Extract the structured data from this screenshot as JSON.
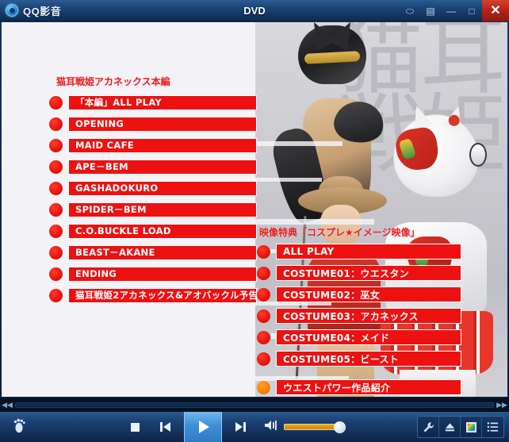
{
  "titlebar": {
    "app_name": "QQ影音",
    "title": "DVD",
    "buttons": [
      {
        "name": "feedback-button",
        "icon": "speech-bubble-icon",
        "glyph": "⬭"
      },
      {
        "name": "skin-button",
        "icon": "form-list-icon",
        "glyph": "▤"
      },
      {
        "name": "minimize-button",
        "icon": "minimize-icon",
        "glyph": "—"
      },
      {
        "name": "maximize-button",
        "icon": "maximize-icon",
        "glyph": "□"
      },
      {
        "name": "close-button",
        "icon": "close-icon",
        "glyph": "✕"
      }
    ]
  },
  "dvd_menu": {
    "left": {
      "title": "猫耳戦姫アカネックス本編",
      "items": [
        {
          "label": "「本編」ALL PLAY",
          "bullet": "red"
        },
        {
          "label": "OPENING",
          "bullet": "red"
        },
        {
          "label": "MAID CAFE",
          "bullet": "red"
        },
        {
          "label": "APE－BEM",
          "bullet": "red"
        },
        {
          "label": "GASHADOKURO",
          "bullet": "red"
        },
        {
          "label": "SPIDER－BEM",
          "bullet": "red"
        },
        {
          "label": "C.O.BUCKLE LOAD",
          "bullet": "red"
        },
        {
          "label": "BEAST－AKANE",
          "bullet": "red"
        },
        {
          "label": "ENDING",
          "bullet": "red"
        },
        {
          "label": "猫耳戦姫2アカネックス&アオバックル予告",
          "bullet": "red"
        }
      ]
    },
    "right": {
      "title": "映像特典「コスプレ★イメージ映像」",
      "items": [
        {
          "label": "ALL  PLAY",
          "bullet": "red"
        },
        {
          "label": "COSTUME01：ウエスタン",
          "bullet": "red"
        },
        {
          "label": "COSTUME02：巫女",
          "bullet": "red"
        },
        {
          "label": "COSTUME03：アカネックス",
          "bullet": "red"
        },
        {
          "label": "COSTUME04：メイド",
          "bullet": "red"
        },
        {
          "label": "COSTUME05：ビースト",
          "bullet": "red"
        }
      ],
      "extra": {
        "label": "ウエストパワー作品紹介",
        "bullet": "orange"
      }
    },
    "backdrop_text": "猫耳\n戦姫"
  },
  "seekbar": {
    "rewind_glyph": "◀◀",
    "forward_glyph": "▶▶",
    "position_percent": 0
  },
  "controls": {
    "footprint_icon": "footprint-icon",
    "stop_glyph": "■",
    "previous_glyph": "⏮",
    "play_glyph": "▶",
    "next_glyph": "⏭",
    "volume_icon_glyph": "◀)",
    "volume_percent": 100,
    "right_tools": [
      {
        "name": "settings-button",
        "icon": "wrench-icon",
        "glyph": "🔧"
      },
      {
        "name": "eject-button",
        "icon": "eject-icon",
        "glyph": "⏏"
      },
      {
        "name": "screenshot-button",
        "icon": "color-square-icon",
        "glyph": ""
      },
      {
        "name": "playlist-button",
        "icon": "playlist-icon",
        "glyph": "☰"
      }
    ]
  },
  "colors": {
    "menu_red": "#ee1111",
    "bullet_red": "#e8170f",
    "bullet_orange": "#f58210",
    "title_red": "#ef1b1b",
    "accent_blue": "#3f8fd8",
    "close_red": "#b22418",
    "volume_gold": "#e8a81c"
  }
}
